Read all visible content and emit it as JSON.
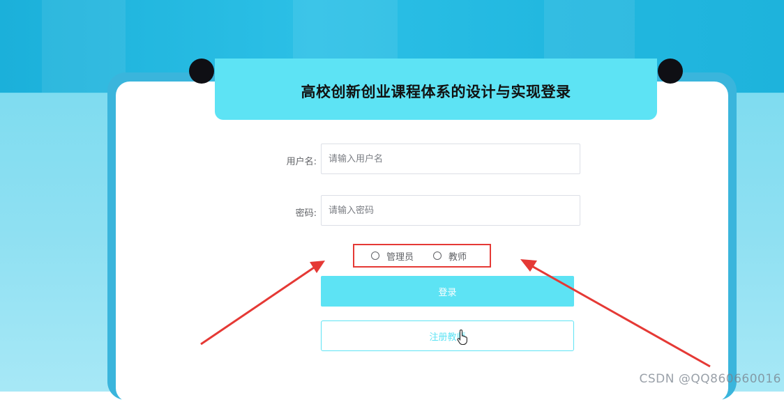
{
  "title": "高校创新创业课程体系的设计与实现登录",
  "form": {
    "username_label": "用户名:",
    "username_placeholder": "请输入用户名",
    "username_value": "",
    "password_label": "密码:",
    "password_placeholder": "请输入密码",
    "password_value": ""
  },
  "roles": {
    "options": [
      "管理员",
      "教师"
    ],
    "selected": null
  },
  "buttons": {
    "login_label": "登录",
    "register_label": "注册教师"
  },
  "watermark": "CSDN @QQ860660016",
  "colors": {
    "accent": "#5de3f4",
    "highlight_border": "#e53935",
    "arrow": "#e53935"
  },
  "icons": {
    "cursor": "hand-pointer-icon"
  }
}
